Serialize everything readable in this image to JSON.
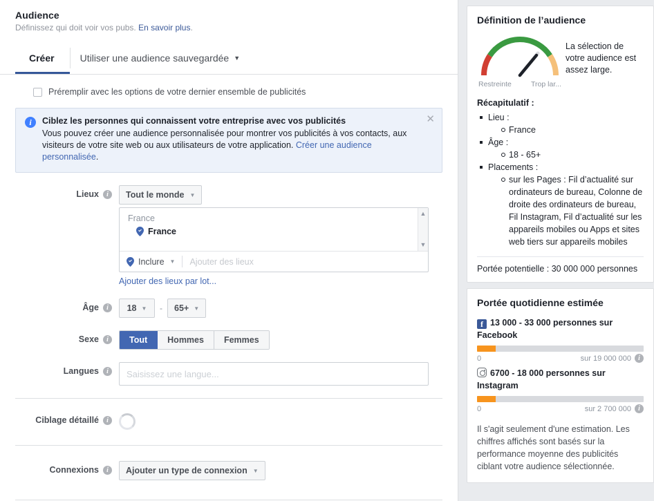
{
  "header": {
    "title": "Audience",
    "subtitle": "Définissez qui doit voir vos pubs.",
    "learn_more": "En savoir plus",
    "period": "."
  },
  "tabs": {
    "create": "Créer",
    "saved": "Utiliser une audience sauvegardée",
    "caret": "▼"
  },
  "prefill": {
    "label": "Préremplir avec les options de votre dernier ensemble de publicités",
    "checked": false
  },
  "banner": {
    "title": "Ciblez les personnes qui connaissent votre entreprise avec vos publicités",
    "body_1": "Vous pouvez créer une audience personnalisée pour montrer vos publicités à vos contacts, aux visiteurs de votre site web ou aux utilisateurs de votre application. ",
    "link": "Créer une audience personnalisée",
    "body_2": ".",
    "close": "✕",
    "icon": "info-icon"
  },
  "locations": {
    "label": "Lieux",
    "scope_value": "Tout le monde",
    "group_header": "France",
    "selected": "France",
    "include_label": "Inclure",
    "add_placeholder": "Ajouter des lieux",
    "batch_link": "Ajouter des lieux par lot...",
    "caret": "▼",
    "scroll_up": "▲",
    "scroll_down": "▼"
  },
  "age": {
    "label": "Âge",
    "min": "18",
    "max": "65+",
    "dash": "-",
    "caret": "▼"
  },
  "gender": {
    "label": "Sexe",
    "options": [
      "Tout",
      "Hommes",
      "Femmes"
    ],
    "selected": "Tout"
  },
  "languages": {
    "label": "Langues",
    "value": "",
    "placeholder": "Saisissez une langue..."
  },
  "detailed_targeting": {
    "label": "Ciblage détaillé",
    "status": "loading"
  },
  "connections": {
    "label": "Connexions",
    "value": "Ajouter un type de connexion",
    "caret": "▼"
  },
  "definition": {
    "title": "Définition de l’audience",
    "gauge_left_label": "Restreinte",
    "gauge_right_label": "Trop lar...",
    "message": "La sélection de votre audience est assez large.",
    "gauge_colors": {
      "red": "#d13f32",
      "green": "#3a9a41",
      "orange": "#f5c07a"
    },
    "recap_title": "Récapitulatif :",
    "recap": [
      {
        "label": "Lieu :",
        "children": [
          "France"
        ]
      },
      {
        "label": "Âge :",
        "children": [
          "18 - 65+"
        ]
      },
      {
        "label": "Placements :",
        "children": [
          "sur les Pages : Fil d’actualité sur ordinateurs de bureau, Colonne de droite des ordinateurs de bureau, Fil Instagram, Fil d’actualité sur les appareils mobiles ou Apps et sites web tiers sur appareils mobiles"
        ]
      }
    ],
    "potential_reach": "Portée potentielle : 30 000 000 personnes"
  },
  "daily": {
    "title": "Portée quotidienne estimée",
    "facebook": {
      "icon": "facebook-icon",
      "text": "13 000 - 33 000 personnes sur Facebook",
      "low": "0",
      "high": "sur 19 000 000",
      "fill_percent": 11
    },
    "instagram": {
      "icon": "instagram-icon",
      "text": "6700 - 18 000 personnes sur Instagram",
      "low": "0",
      "high": "sur 2 700 000",
      "fill_percent": 11
    },
    "disclaimer": "Il s'agit seulement d'une estimation. Les chiffres affichés sont basés sur la performance moyenne des publicités ciblant votre audience sélectionnée."
  }
}
